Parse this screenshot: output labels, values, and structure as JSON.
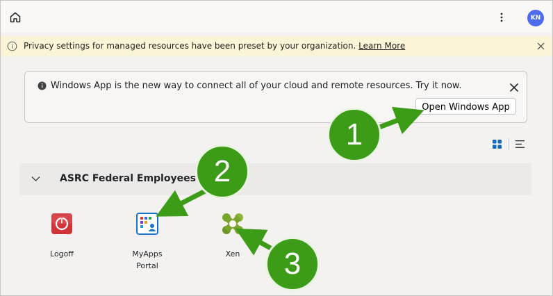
{
  "header": {
    "home_icon": "home-icon",
    "more_icon": "more-vertical-icon",
    "avatar_initials": "KN",
    "avatar_color": "#4f6bed"
  },
  "privacy_bar": {
    "text": "Privacy settings for managed resources have been preset by your organization.",
    "link": "Learn More",
    "background": "#fcf4d6"
  },
  "promo": {
    "message": "Windows App is the new way to connect all of your cloud and remote resources. Try it now.",
    "button_label": "Open Windows App"
  },
  "view_toggle": {
    "grid_icon": "grid-view-icon",
    "list_icon": "list-view-icon",
    "accent": "#0f6cbd"
  },
  "group": {
    "title": "ASRC Federal Employees",
    "apps": [
      {
        "label": "Logoff",
        "icon": "logoff-icon"
      },
      {
        "label": "MyApps Portal",
        "icon": "myapps-portal-icon"
      },
      {
        "label": "Xen",
        "icon": "xen-icon"
      }
    ]
  },
  "annotations": {
    "callouts": [
      "1",
      "2",
      "3"
    ],
    "color": "#3d9c17"
  }
}
